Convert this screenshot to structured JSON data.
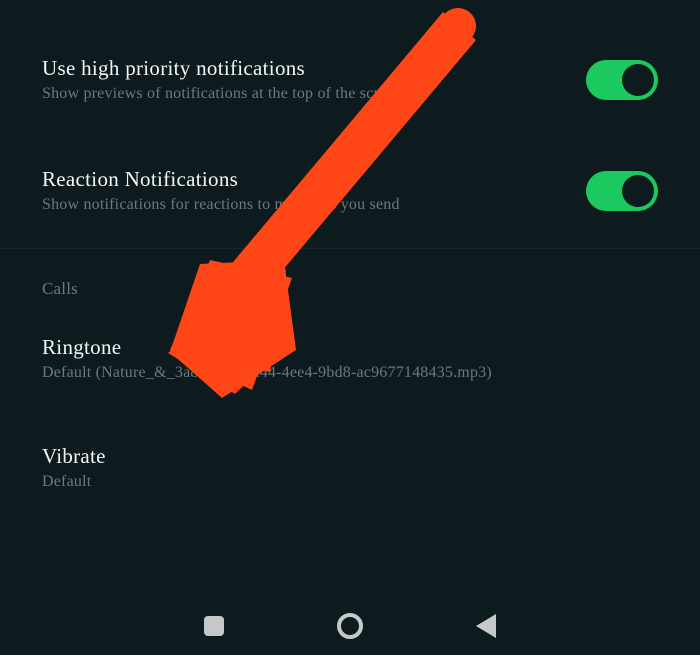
{
  "settings": {
    "priority": {
      "title": "Use high priority notifications",
      "subtitle": "Show previews of notifications at the top of the screen",
      "enabled": true
    },
    "reaction": {
      "title": "Reaction Notifications",
      "subtitle": "Show notifications for reactions to messages you send",
      "enabled": true
    }
  },
  "calls_section": {
    "header": "Calls",
    "ringtone": {
      "title": "Ringtone",
      "subtitle": "Default (Nature_&_3a845372-aa44-4ee4-9bd8-ac9677148435.mp3)"
    },
    "vibrate": {
      "title": "Vibrate",
      "subtitle": "Default"
    }
  },
  "annotation": {
    "arrow_color": "#ff4617"
  }
}
